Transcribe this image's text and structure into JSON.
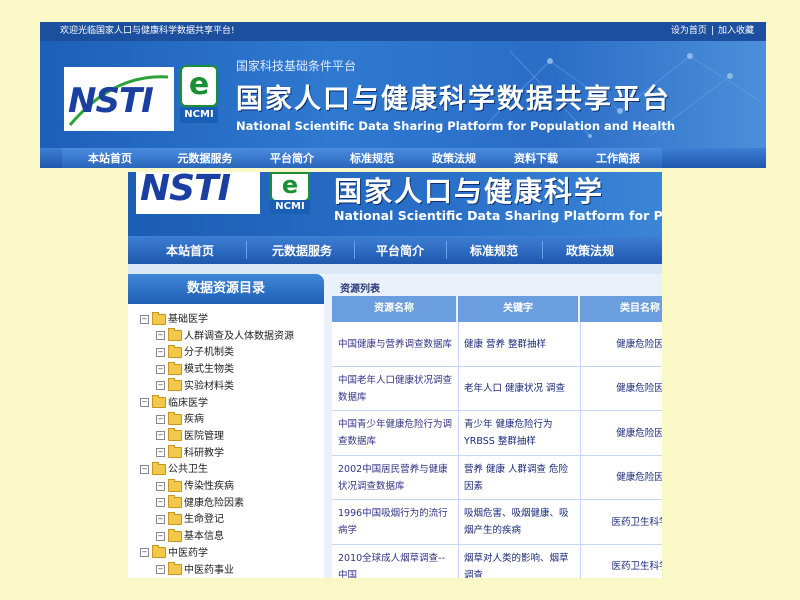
{
  "top": {
    "welcome": "欢迎光临国家人口与健康科学数据共享平台!",
    "links": [
      "设为首页",
      "加入收藏"
    ],
    "link_sep": "|",
    "logo_text": "NSTI",
    "e_logo": "e",
    "ncmi": "NCMI",
    "subtitle": "国家科技基础条件平台",
    "title_cn": "国家人口与健康科学数据共享平台",
    "title_en": "National Scientific Data Sharing Platform for Population and Health",
    "nav": [
      "本站首页",
      "元数据服务",
      "平台简介",
      "标准规范",
      "政策法规",
      "资料下载",
      "工作简报"
    ]
  },
  "bottom": {
    "logo_text": "NSTI",
    "e_logo": "e",
    "ncmi": "NCMI",
    "title_cn": "国家人口与健康科学",
    "title_en": "National Scientific Data Sharing Platform for Popula",
    "nav": [
      "本站首页",
      "元数据服务",
      "平台简介",
      "标准规范",
      "政策法规"
    ],
    "sidebar": {
      "heading": "数据资源目录",
      "tree": [
        {
          "label": "基础医学",
          "level": 0
        },
        {
          "label": "人群调查及人体数据资源",
          "level": 1
        },
        {
          "label": "分子机制类",
          "level": 1
        },
        {
          "label": "模式生物类",
          "level": 1
        },
        {
          "label": "实验材料类",
          "level": 1
        },
        {
          "label": "临床医学",
          "level": 0
        },
        {
          "label": "疾病",
          "level": 1
        },
        {
          "label": "医院管理",
          "level": 1
        },
        {
          "label": "科研教学",
          "level": 1
        },
        {
          "label": "公共卫生",
          "level": 0
        },
        {
          "label": "传染性疾病",
          "level": 1
        },
        {
          "label": "健康危险因素",
          "level": 1
        },
        {
          "label": "生命登记",
          "level": 1
        },
        {
          "label": "基本信息",
          "level": 1
        },
        {
          "label": "中医药学",
          "level": 0
        },
        {
          "label": "中医药事业",
          "level": 1
        }
      ]
    },
    "list_title": "资源列表",
    "columns": [
      "资源名称",
      "关键字",
      "类目名称"
    ],
    "rows": [
      {
        "name": "中国健康与营养调查数据库",
        "keywords": "健康 营养 整群抽样",
        "category": "健康危险因"
      },
      {
        "name": "中国老年人口健康状况调查数据库",
        "keywords": "老年人口 健康状况 调查",
        "category": "健康危险因"
      },
      {
        "name": "中国青少年健康危险行为调查数据库",
        "keywords": "青少年 健康危险行为 YRBSS 整群抽样",
        "category": "健康危险因"
      },
      {
        "name": "2002中国居民营养与健康状况调查数据库",
        "keywords": "营养 健康 人群调查 危险因素",
        "category": "健康危险因"
      },
      {
        "name": "1996中国吸烟行为的流行病学",
        "keywords": "吸烟危害、吸烟健康、吸烟产生的疾病",
        "category": "医药卫生科学"
      },
      {
        "name": "2010全球成人烟草调查--中国",
        "keywords": "烟草对人类的影响、烟草调查",
        "category": "医药卫生科学"
      }
    ]
  }
}
